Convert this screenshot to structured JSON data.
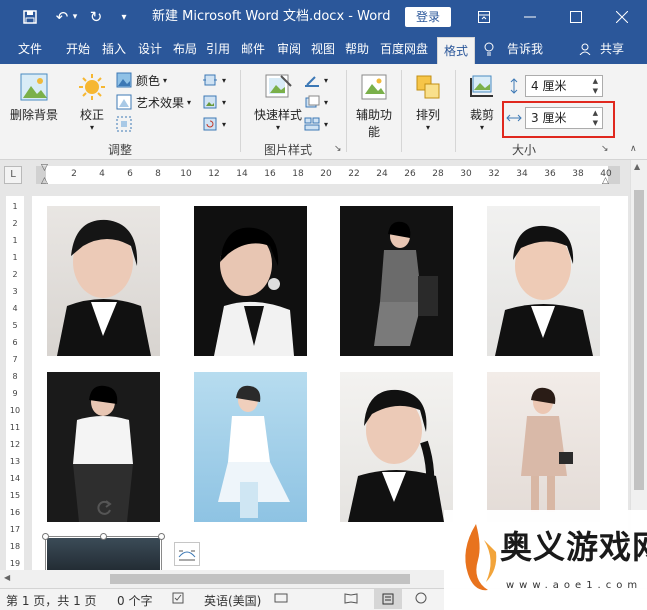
{
  "titlebar": {
    "title": "新建 Microsoft Word 文档.docx  -  Word",
    "login_label": "登录"
  },
  "tabs": [
    {
      "label": "文件"
    },
    {
      "label": "开始"
    },
    {
      "label": "插入"
    },
    {
      "label": "设计"
    },
    {
      "label": "布局"
    },
    {
      "label": "引用"
    },
    {
      "label": "邮件"
    },
    {
      "label": "审阅"
    },
    {
      "label": "视图"
    },
    {
      "label": "帮助"
    },
    {
      "label": "百度网盘"
    },
    {
      "label": "格式",
      "active": true
    },
    {
      "label": "告诉我"
    },
    {
      "label": "共享"
    }
  ],
  "ribbon": {
    "remove_bg": "删除背景",
    "correct": "校正",
    "color": "颜色",
    "art_effect": "艺术效果",
    "adjust_group": "调整",
    "quick_style": "快速样式",
    "picture_style_group": "图片样式",
    "alt_text_l1": "辅助功",
    "alt_text_l2": "能",
    "arrange": "排列",
    "crop": "裁剪",
    "height_value": "4 厘米",
    "width_value": "3 厘米",
    "size_group": "大小"
  },
  "ruler": {
    "corner": "L",
    "ticks": [
      "2",
      "4",
      "6",
      "8",
      "10",
      "12",
      "14",
      "16",
      "18",
      "20",
      "22",
      "24",
      "26",
      "28",
      "30",
      "32",
      "34",
      "36",
      "38",
      "40"
    ]
  },
  "vruler": {
    "ticks": [
      "1",
      "2",
      "1",
      "1",
      "2",
      "3",
      "4",
      "5",
      "6",
      "7",
      "8",
      "9",
      "10",
      "11",
      "12",
      "13",
      "14",
      "15",
      "16",
      "17",
      "18",
      "19"
    ]
  },
  "status": {
    "page": "第 1 页，共 1 页",
    "words": "0 个字",
    "lang": "英语(美国)"
  },
  "watermark": {
    "text": "奥义游戏网",
    "url": "www.aoe1.com"
  },
  "colors": {
    "brand": "#2b579a",
    "highlight": "#e0281e"
  }
}
